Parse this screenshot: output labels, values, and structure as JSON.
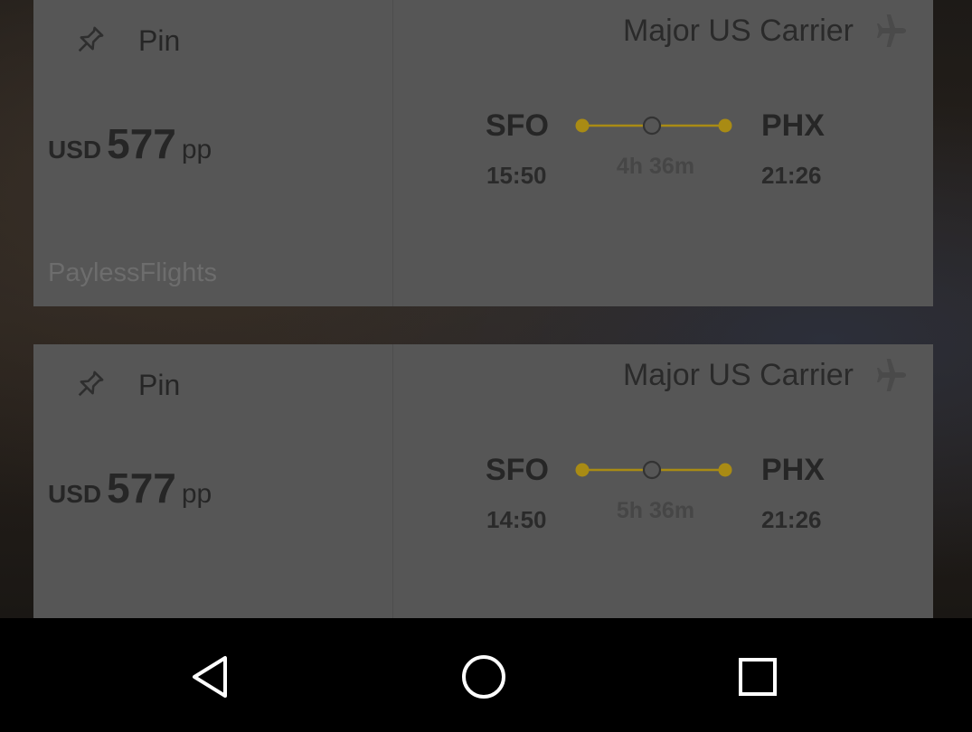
{
  "colors": {
    "card_background": "#565656",
    "route_accent": "#a98b14",
    "text_dark": "#262626",
    "navbar": "#000000"
  },
  "results": [
    {
      "pin_icon": "pushpin-icon",
      "pin_label": "Pin",
      "price": {
        "currency": "USD",
        "amount": "577",
        "unit": "pp"
      },
      "agent": "PaylessFlights",
      "carrier": "Major US Carrier",
      "carrier_icon": "airplane-icon",
      "origin": "SFO",
      "destination": "PHX",
      "departure_time": "15:50",
      "arrival_time": "21:26",
      "duration": "4h 36m",
      "stops_indicator": "one-stop"
    },
    {
      "pin_icon": "pushpin-icon",
      "pin_label": "Pin",
      "price": {
        "currency": "USD",
        "amount": "577",
        "unit": "pp"
      },
      "agent": "",
      "carrier": "Major US Carrier",
      "carrier_icon": "airplane-icon",
      "origin": "SFO",
      "destination": "PHX",
      "departure_time": "14:50",
      "arrival_time": "21:26",
      "duration": "5h 36m",
      "stops_indicator": "one-stop"
    }
  ],
  "navbar": {
    "back_icon": "back-triangle-icon",
    "home_icon": "home-circle-icon",
    "recents_icon": "recents-square-icon"
  }
}
